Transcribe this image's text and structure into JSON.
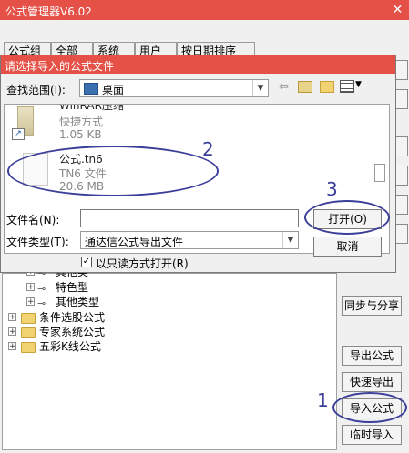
{
  "main_window": {
    "title": "公式管理器V6.02",
    "close_glyph": "✕",
    "tabs": [
      "公式组",
      "全部",
      "系统",
      "用户",
      "按日期排序"
    ]
  },
  "dialog": {
    "title": "请选择导入的公式文件",
    "look_in_label": "查找范围(I):",
    "look_in_value": "桌面",
    "files": [
      {
        "name": "WinRAR压缩",
        "type": "快捷方式",
        "size": "1.05 KB"
      },
      {
        "name": "公式.tn6",
        "type": "TN6 文件",
        "size": "20.6 MB"
      }
    ],
    "filename_label": "文件名(N):",
    "filename_value": "",
    "filetype_label": "文件类型(T):",
    "filetype_value": "通达信公式导出文件",
    "open_button": "打开(O)",
    "cancel_button": "取消",
    "readonly_label": "以只读方式打开(R)",
    "readonly_checked": true
  },
  "tree": {
    "items": [
      {
        "label": "其他类",
        "expander": "+",
        "icon": "key"
      },
      {
        "label": "特色型",
        "expander": "+",
        "icon": "key"
      },
      {
        "label": "其他类型",
        "expander": "+",
        "icon": "key"
      },
      {
        "label": "条件选股公式",
        "expander": "+",
        "icon": "folder"
      },
      {
        "label": "专家系统公式",
        "expander": "+",
        "icon": "folder"
      },
      {
        "label": "五彩K线公式",
        "expander": "+",
        "icon": "folder"
      }
    ]
  },
  "right_buttons": {
    "sync_share": "同步与分享",
    "export": "导出公式",
    "quick_export": "快速导出",
    "import": "导入公式",
    "temp_import": "临时导入"
  },
  "annotations": {
    "step1": "1",
    "step2": "2",
    "step3": "3"
  },
  "colors": {
    "titlebar": "#e55047",
    "annotation": "#3b3f9a"
  }
}
